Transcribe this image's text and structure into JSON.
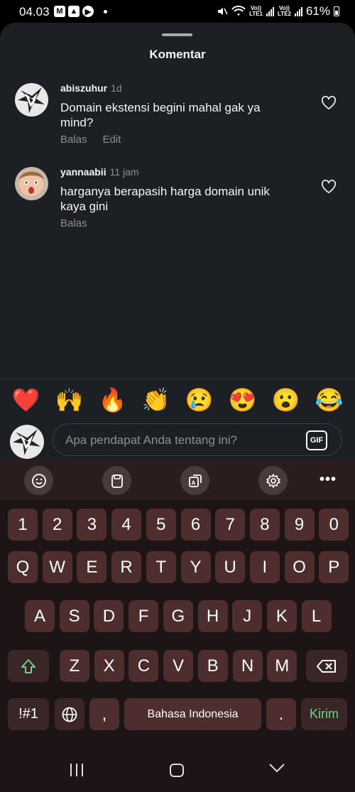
{
  "status_bar": {
    "time": "04.03",
    "battery": "61%",
    "sim1": "LTE1",
    "sim2": "LTE2",
    "volte": "Vo))"
  },
  "sheet": {
    "title": "Komentar"
  },
  "comments": [
    {
      "username": "abiszuhur",
      "time": "1d",
      "text": "Domain ekstensi begini mahal gak ya mind?",
      "actions": [
        "Balas",
        "Edit"
      ]
    },
    {
      "username": "yannaabii",
      "time": "11 jam",
      "text": "harganya berapasih harga domain unik kaya gini",
      "actions": [
        "Balas"
      ]
    }
  ],
  "reactions": [
    "❤️",
    "🙌",
    "🔥",
    "👏",
    "😢",
    "😍",
    "😮",
    "😂"
  ],
  "compose": {
    "placeholder": "Apa pendapat Anda tentang ini?",
    "gif_label": "GIF"
  },
  "keyboard": {
    "row_numbers": [
      "1",
      "2",
      "3",
      "4",
      "5",
      "6",
      "7",
      "8",
      "9",
      "0"
    ],
    "row_top": [
      "Q",
      "W",
      "E",
      "R",
      "T",
      "Y",
      "U",
      "I",
      "O",
      "P"
    ],
    "row_middle": [
      "A",
      "S",
      "D",
      "F",
      "G",
      "H",
      "J",
      "K",
      "L"
    ],
    "row_bottom": [
      "Z",
      "X",
      "C",
      "V",
      "B",
      "N",
      "M"
    ],
    "symbols_label": "!#1",
    "comma_label": ",",
    "space_label": "Bahasa Indonesia",
    "period_label": ".",
    "send_label": "Kirim",
    "toolbar_more": "•••"
  },
  "colors": {
    "sheet_bg": "#1c1f24",
    "key_bg": "#4e2d2e",
    "send_green": "#6dd28a"
  }
}
